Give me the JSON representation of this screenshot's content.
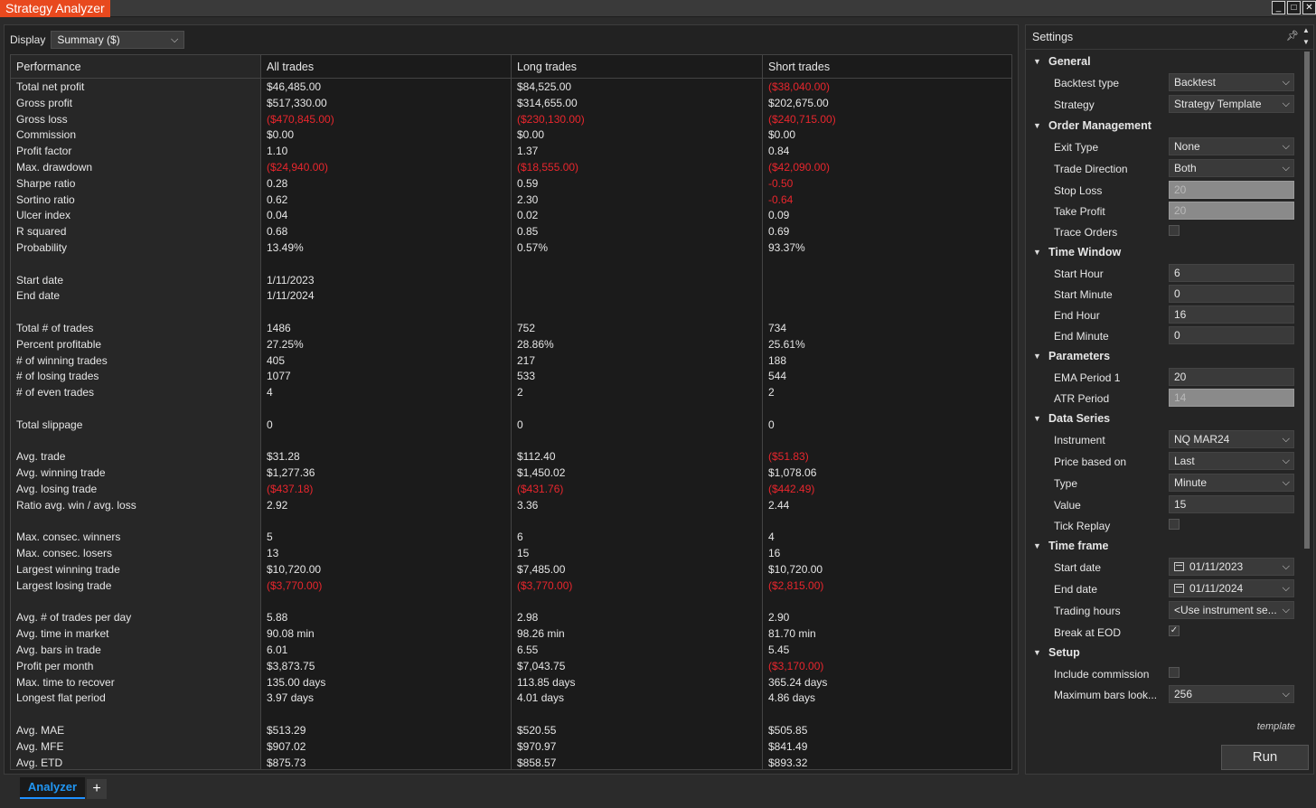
{
  "window": {
    "title": "Strategy Analyzer"
  },
  "display": {
    "label": "Display",
    "value": "Summary ($)"
  },
  "table": {
    "headers": [
      "Performance",
      "All trades",
      "Long trades",
      "Short trades"
    ],
    "rows": [
      {
        "label": "Total net profit",
        "cells": [
          {
            "v": "$46,485.00",
            "neg": false
          },
          {
            "v": "$84,525.00",
            "neg": false
          },
          {
            "v": "($38,040.00)",
            "neg": true
          }
        ]
      },
      {
        "label": "Gross profit",
        "cells": [
          {
            "v": "$517,330.00",
            "neg": false
          },
          {
            "v": "$314,655.00",
            "neg": false
          },
          {
            "v": "$202,675.00",
            "neg": false
          }
        ]
      },
      {
        "label": "Gross loss",
        "cells": [
          {
            "v": "($470,845.00)",
            "neg": true
          },
          {
            "v": "($230,130.00)",
            "neg": true
          },
          {
            "v": "($240,715.00)",
            "neg": true
          }
        ]
      },
      {
        "label": "Commission",
        "cells": [
          {
            "v": "$0.00",
            "neg": false
          },
          {
            "v": "$0.00",
            "neg": false
          },
          {
            "v": "$0.00",
            "neg": false
          }
        ]
      },
      {
        "label": "Profit factor",
        "cells": [
          {
            "v": "1.10",
            "neg": false
          },
          {
            "v": "1.37",
            "neg": false
          },
          {
            "v": "0.84",
            "neg": false
          }
        ]
      },
      {
        "label": "Max. drawdown",
        "cells": [
          {
            "v": "($24,940.00)",
            "neg": true
          },
          {
            "v": "($18,555.00)",
            "neg": true
          },
          {
            "v": "($42,090.00)",
            "neg": true
          }
        ]
      },
      {
        "label": "Sharpe ratio",
        "cells": [
          {
            "v": "0.28",
            "neg": false
          },
          {
            "v": "0.59",
            "neg": false
          },
          {
            "v": "-0.50",
            "neg": true
          }
        ]
      },
      {
        "label": "Sortino ratio",
        "cells": [
          {
            "v": "0.62",
            "neg": false
          },
          {
            "v": "2.30",
            "neg": false
          },
          {
            "v": "-0.64",
            "neg": true
          }
        ]
      },
      {
        "label": "Ulcer index",
        "cells": [
          {
            "v": "0.04",
            "neg": false
          },
          {
            "v": "0.02",
            "neg": false
          },
          {
            "v": "0.09",
            "neg": false
          }
        ]
      },
      {
        "label": "R squared",
        "cells": [
          {
            "v": "0.68",
            "neg": false
          },
          {
            "v": "0.85",
            "neg": false
          },
          {
            "v": "0.69",
            "neg": false
          }
        ]
      },
      {
        "label": "Probability",
        "cells": [
          {
            "v": "13.49%",
            "neg": false
          },
          {
            "v": "0.57%",
            "neg": false
          },
          {
            "v": "93.37%",
            "neg": false
          }
        ]
      },
      {
        "label": "",
        "cells": [
          {
            "v": "",
            "neg": false
          },
          {
            "v": "",
            "neg": false
          },
          {
            "v": "",
            "neg": false
          }
        ]
      },
      {
        "label": "Start date",
        "cells": [
          {
            "v": "1/11/2023",
            "neg": false
          },
          {
            "v": "",
            "neg": false
          },
          {
            "v": "",
            "neg": false
          }
        ]
      },
      {
        "label": "End date",
        "cells": [
          {
            "v": "1/11/2024",
            "neg": false
          },
          {
            "v": "",
            "neg": false
          },
          {
            "v": "",
            "neg": false
          }
        ]
      },
      {
        "label": "",
        "cells": [
          {
            "v": "",
            "neg": false
          },
          {
            "v": "",
            "neg": false
          },
          {
            "v": "",
            "neg": false
          }
        ]
      },
      {
        "label": "Total # of trades",
        "cells": [
          {
            "v": "1486",
            "neg": false
          },
          {
            "v": "752",
            "neg": false
          },
          {
            "v": "734",
            "neg": false
          }
        ]
      },
      {
        "label": "Percent profitable",
        "cells": [
          {
            "v": "27.25%",
            "neg": false
          },
          {
            "v": "28.86%",
            "neg": false
          },
          {
            "v": "25.61%",
            "neg": false
          }
        ]
      },
      {
        "label": "# of winning trades",
        "cells": [
          {
            "v": "405",
            "neg": false
          },
          {
            "v": "217",
            "neg": false
          },
          {
            "v": "188",
            "neg": false
          }
        ]
      },
      {
        "label": "# of losing trades",
        "cells": [
          {
            "v": "1077",
            "neg": false
          },
          {
            "v": "533",
            "neg": false
          },
          {
            "v": "544",
            "neg": false
          }
        ]
      },
      {
        "label": "# of even trades",
        "cells": [
          {
            "v": "4",
            "neg": false
          },
          {
            "v": "2",
            "neg": false
          },
          {
            "v": "2",
            "neg": false
          }
        ]
      },
      {
        "label": "",
        "cells": [
          {
            "v": "",
            "neg": false
          },
          {
            "v": "",
            "neg": false
          },
          {
            "v": "",
            "neg": false
          }
        ]
      },
      {
        "label": "Total slippage",
        "cells": [
          {
            "v": "0",
            "neg": false
          },
          {
            "v": "0",
            "neg": false
          },
          {
            "v": "0",
            "neg": false
          }
        ]
      },
      {
        "label": "",
        "cells": [
          {
            "v": "",
            "neg": false
          },
          {
            "v": "",
            "neg": false
          },
          {
            "v": "",
            "neg": false
          }
        ]
      },
      {
        "label": "Avg. trade",
        "cells": [
          {
            "v": "$31.28",
            "neg": false
          },
          {
            "v": "$112.40",
            "neg": false
          },
          {
            "v": "($51.83)",
            "neg": true
          }
        ]
      },
      {
        "label": "Avg. winning trade",
        "cells": [
          {
            "v": "$1,277.36",
            "neg": false
          },
          {
            "v": "$1,450.02",
            "neg": false
          },
          {
            "v": "$1,078.06",
            "neg": false
          }
        ]
      },
      {
        "label": "Avg. losing trade",
        "cells": [
          {
            "v": "($437.18)",
            "neg": true
          },
          {
            "v": "($431.76)",
            "neg": true
          },
          {
            "v": "($442.49)",
            "neg": true
          }
        ]
      },
      {
        "label": "Ratio avg. win / avg. loss",
        "cells": [
          {
            "v": "2.92",
            "neg": false
          },
          {
            "v": "3.36",
            "neg": false
          },
          {
            "v": "2.44",
            "neg": false
          }
        ]
      },
      {
        "label": "",
        "cells": [
          {
            "v": "",
            "neg": false
          },
          {
            "v": "",
            "neg": false
          },
          {
            "v": "",
            "neg": false
          }
        ]
      },
      {
        "label": "Max. consec. winners",
        "cells": [
          {
            "v": "5",
            "neg": false
          },
          {
            "v": "6",
            "neg": false
          },
          {
            "v": "4",
            "neg": false
          }
        ]
      },
      {
        "label": "Max. consec. losers",
        "cells": [
          {
            "v": "13",
            "neg": false
          },
          {
            "v": "15",
            "neg": false
          },
          {
            "v": "16",
            "neg": false
          }
        ]
      },
      {
        "label": "Largest winning trade",
        "cells": [
          {
            "v": "$10,720.00",
            "neg": false
          },
          {
            "v": "$7,485.00",
            "neg": false
          },
          {
            "v": "$10,720.00",
            "neg": false
          }
        ]
      },
      {
        "label": "Largest losing trade",
        "cells": [
          {
            "v": "($3,770.00)",
            "neg": true
          },
          {
            "v": "($3,770.00)",
            "neg": true
          },
          {
            "v": "($2,815.00)",
            "neg": true
          }
        ]
      },
      {
        "label": "",
        "cells": [
          {
            "v": "",
            "neg": false
          },
          {
            "v": "",
            "neg": false
          },
          {
            "v": "",
            "neg": false
          }
        ]
      },
      {
        "label": "Avg. # of trades per day",
        "cells": [
          {
            "v": "5.88",
            "neg": false
          },
          {
            "v": "2.98",
            "neg": false
          },
          {
            "v": "2.90",
            "neg": false
          }
        ]
      },
      {
        "label": "Avg. time in market",
        "cells": [
          {
            "v": "90.08 min",
            "neg": false
          },
          {
            "v": "98.26 min",
            "neg": false
          },
          {
            "v": "81.70 min",
            "neg": false
          }
        ]
      },
      {
        "label": "Avg. bars in trade",
        "cells": [
          {
            "v": "6.01",
            "neg": false
          },
          {
            "v": "6.55",
            "neg": false
          },
          {
            "v": "5.45",
            "neg": false
          }
        ]
      },
      {
        "label": "Profit per month",
        "cells": [
          {
            "v": "$3,873.75",
            "neg": false
          },
          {
            "v": "$7,043.75",
            "neg": false
          },
          {
            "v": "($3,170.00)",
            "neg": true
          }
        ]
      },
      {
        "label": "Max. time to recover",
        "cells": [
          {
            "v": "135.00 days",
            "neg": false
          },
          {
            "v": "113.85 days",
            "neg": false
          },
          {
            "v": "365.24 days",
            "neg": false
          }
        ]
      },
      {
        "label": "Longest flat period",
        "cells": [
          {
            "v": "3.97 days",
            "neg": false
          },
          {
            "v": "4.01 days",
            "neg": false
          },
          {
            "v": "4.86 days",
            "neg": false
          }
        ]
      },
      {
        "label": "",
        "cells": [
          {
            "v": "",
            "neg": false
          },
          {
            "v": "",
            "neg": false
          },
          {
            "v": "",
            "neg": false
          }
        ]
      },
      {
        "label": "Avg. MAE",
        "cells": [
          {
            "v": "$513.29",
            "neg": false
          },
          {
            "v": "$520.55",
            "neg": false
          },
          {
            "v": "$505.85",
            "neg": false
          }
        ]
      },
      {
        "label": "Avg. MFE",
        "cells": [
          {
            "v": "$907.02",
            "neg": false
          },
          {
            "v": "$970.97",
            "neg": false
          },
          {
            "v": "$841.49",
            "neg": false
          }
        ]
      },
      {
        "label": "Avg. ETD",
        "cells": [
          {
            "v": "$875.73",
            "neg": false
          },
          {
            "v": "$858.57",
            "neg": false
          },
          {
            "v": "$893.32",
            "neg": false
          }
        ]
      }
    ]
  },
  "bottom_tabs": {
    "analyzer": "Analyzer",
    "add": "+"
  },
  "settings": {
    "title": "Settings",
    "items": [
      {
        "kind": "section",
        "label": "General"
      },
      {
        "kind": "prop",
        "label": "Backtest type",
        "value": "Backtest",
        "type": "dropdown"
      },
      {
        "kind": "prop",
        "label": "Strategy",
        "value": "Strategy Template",
        "type": "dropdown"
      },
      {
        "kind": "section",
        "label": "Order Management"
      },
      {
        "kind": "prop",
        "label": "Exit Type",
        "value": "None",
        "type": "dropdown"
      },
      {
        "kind": "prop",
        "label": "Trade Direction",
        "value": "Both",
        "type": "dropdown"
      },
      {
        "kind": "prop",
        "label": "Stop Loss",
        "value": "20",
        "type": "disabled"
      },
      {
        "kind": "prop",
        "label": "Take Profit",
        "value": "20",
        "type": "disabled"
      },
      {
        "kind": "prop",
        "label": "Trace Orders",
        "value": "",
        "type": "checkbox",
        "checked": false
      },
      {
        "kind": "section",
        "label": "Time Window"
      },
      {
        "kind": "prop",
        "label": "Start Hour",
        "value": "6",
        "type": "text"
      },
      {
        "kind": "prop",
        "label": "Start Minute",
        "value": "0",
        "type": "text"
      },
      {
        "kind": "prop",
        "label": "End Hour",
        "value": "16",
        "type": "text"
      },
      {
        "kind": "prop",
        "label": "End Minute",
        "value": "0",
        "type": "text"
      },
      {
        "kind": "section",
        "label": "Parameters"
      },
      {
        "kind": "prop",
        "label": "EMA Period 1",
        "value": "20",
        "type": "text"
      },
      {
        "kind": "prop",
        "label": "ATR Period",
        "value": "14",
        "type": "disabled"
      },
      {
        "kind": "section",
        "label": "Data Series"
      },
      {
        "kind": "prop",
        "label": "Instrument",
        "value": "NQ MAR24",
        "type": "dropdown"
      },
      {
        "kind": "prop",
        "label": "Price based on",
        "value": "Last",
        "type": "dropdown"
      },
      {
        "kind": "prop",
        "label": "Type",
        "value": "Minute",
        "type": "dropdown"
      },
      {
        "kind": "prop",
        "label": "Value",
        "value": "15",
        "type": "text"
      },
      {
        "kind": "prop",
        "label": "Tick Replay",
        "value": "",
        "type": "checkbox",
        "checked": false
      },
      {
        "kind": "section",
        "label": "Time frame"
      },
      {
        "kind": "prop",
        "label": "Start date",
        "value": "01/11/2023",
        "type": "date"
      },
      {
        "kind": "prop",
        "label": "End date",
        "value": "01/11/2024",
        "type": "date"
      },
      {
        "kind": "prop",
        "label": "Trading hours",
        "value": "<Use instrument se...",
        "type": "dropdown"
      },
      {
        "kind": "prop",
        "label": "Break at EOD",
        "value": "",
        "type": "checkbox",
        "checked": true
      },
      {
        "kind": "section",
        "label": "Setup"
      },
      {
        "kind": "prop",
        "label": "Include commission",
        "value": "",
        "type": "checkbox",
        "checked": false
      },
      {
        "kind": "prop",
        "label": "Maximum bars look...",
        "value": "256",
        "type": "dropdown"
      }
    ],
    "template_label": "template",
    "run_label": "Run"
  }
}
